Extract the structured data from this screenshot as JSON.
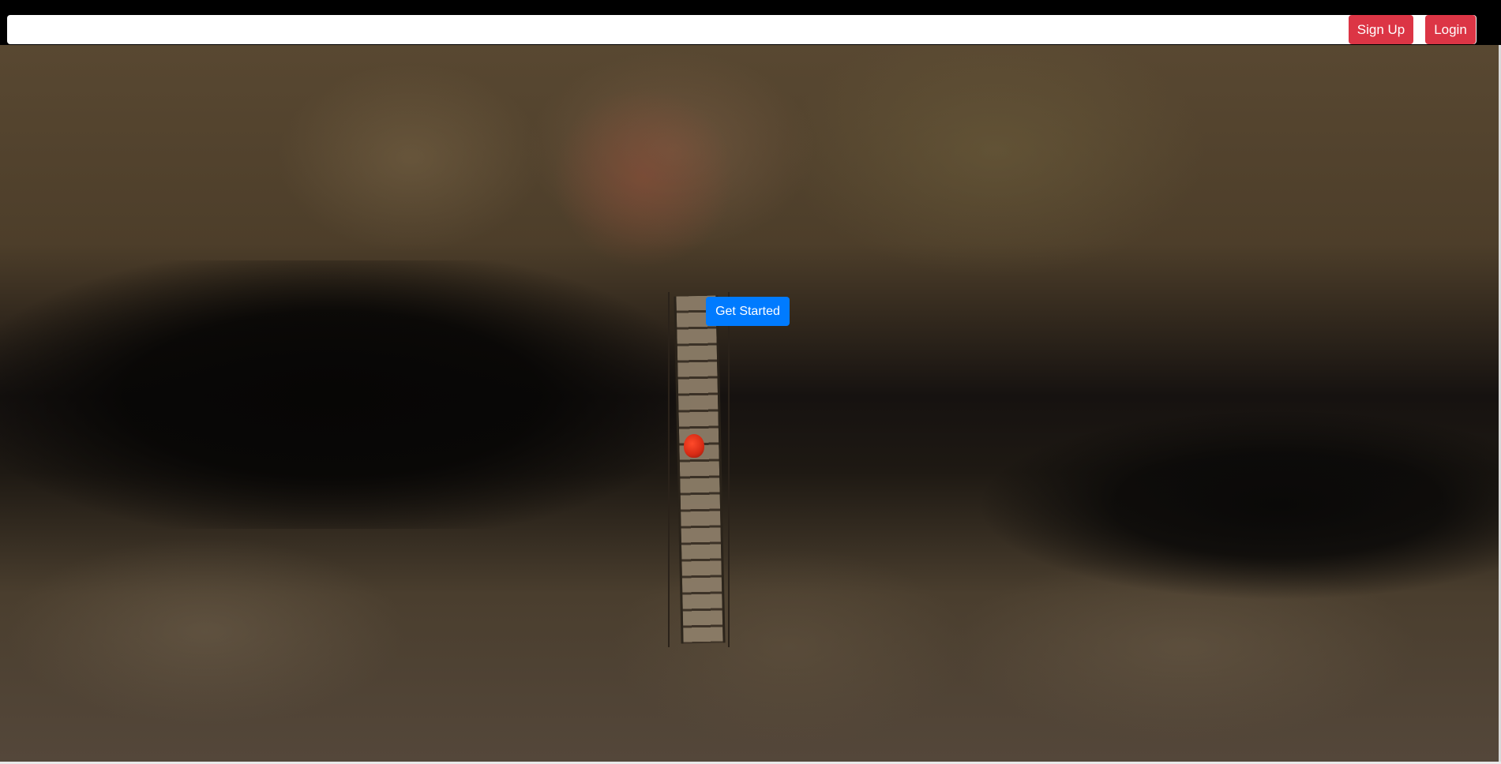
{
  "header": {
    "signup_label": "Sign Up",
    "login_label": "Login",
    "search_value": "",
    "search_placeholder": ""
  },
  "hero": {
    "cta_label": "Get Started"
  },
  "colors": {
    "nav_background": "#000000",
    "danger_button": "#dc3545",
    "primary_button": "#007bff",
    "field_background": "#ffffff"
  }
}
